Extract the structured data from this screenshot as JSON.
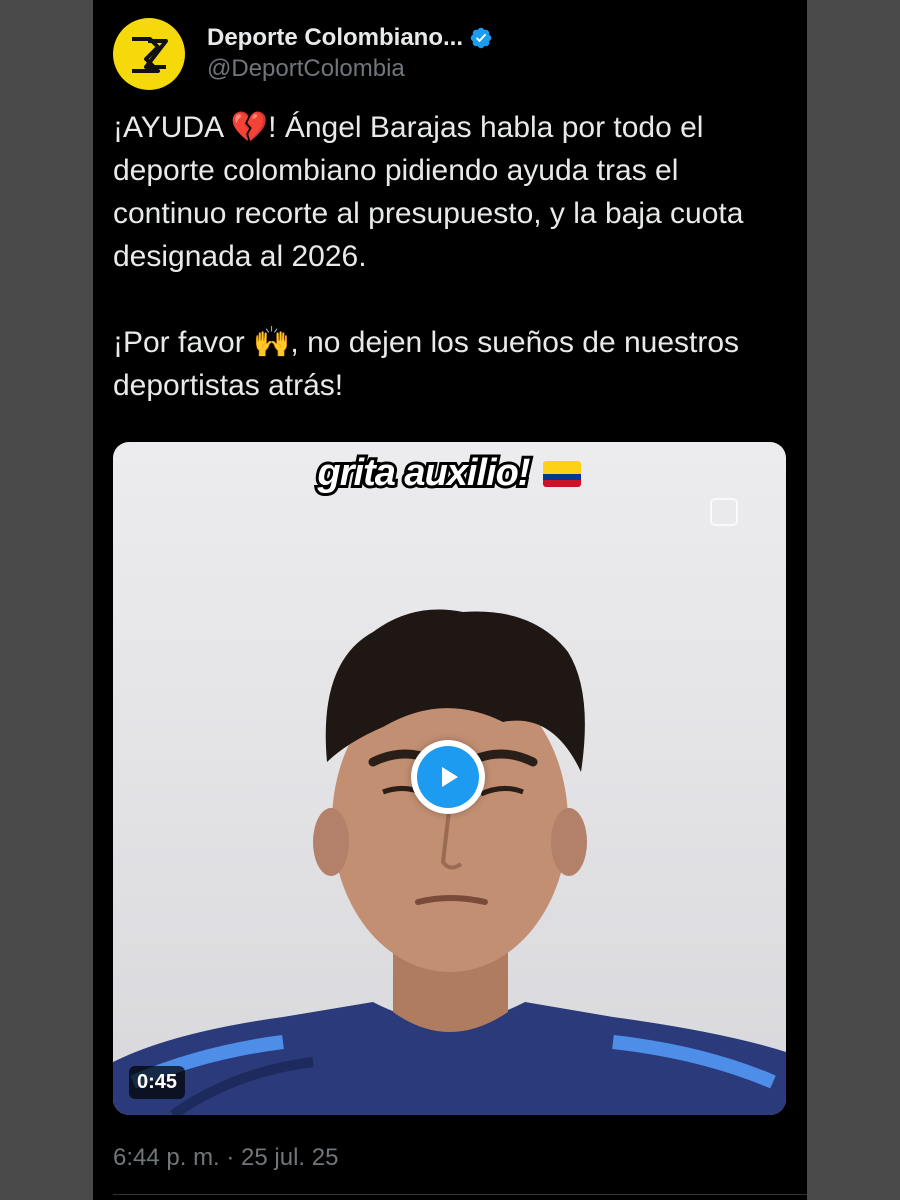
{
  "author": {
    "display_name": "Deporte Colombiano...",
    "handle": "@DeportColombia",
    "avatar_text": "DZ"
  },
  "tweet": {
    "paragraph_1_a": "¡AYUDA ",
    "paragraph_1_emoji": "💔",
    "paragraph_1_b": "! Ángel Barajas habla por todo el deporte colombiano pidiendo ayuda tras el continuo recorte al presupuesto, y la baja cuota designada al 2026.",
    "paragraph_2_a": "¡Por favor ",
    "paragraph_2_emoji": "🙌",
    "paragraph_2_b": ", no dejen los sueños de nuestros deportistas atrás!"
  },
  "media": {
    "overlay_caption": "grita auxilio!",
    "duration": "0:45"
  },
  "timestamp": "6:44 p. m. · 25 jul. 25",
  "colors": {
    "background": "#000000",
    "text": "#e7e9ea",
    "muted": "#71767b",
    "accent": "#1d9bf0",
    "avatar": "#f5d90a"
  },
  "icons": {
    "verified": "verified-badge-icon",
    "play": "play-icon",
    "flag": "colombia-flag-icon",
    "heart": "broken-heart-icon",
    "hands": "raising-hands-icon"
  }
}
